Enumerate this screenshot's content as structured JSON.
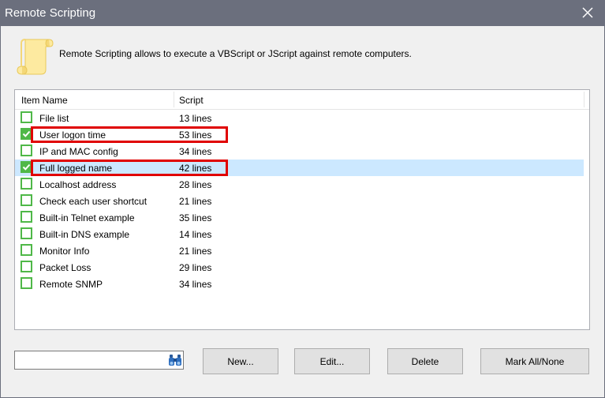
{
  "window": {
    "title": "Remote Scripting"
  },
  "description": "Remote Scripting allows to execute a VBScript or JScript against remote computers.",
  "list": {
    "columns": {
      "name": "Item Name",
      "script": "Script"
    },
    "rows": [
      {
        "name": "File list",
        "lines": "13 lines",
        "checked": false,
        "selected": false,
        "highlighted": false
      },
      {
        "name": "User logon time",
        "lines": "53 lines",
        "checked": true,
        "selected": false,
        "highlighted": true
      },
      {
        "name": "IP and MAC config",
        "lines": "34 lines",
        "checked": false,
        "selected": false,
        "highlighted": false
      },
      {
        "name": "Full logged name",
        "lines": "42 lines",
        "checked": true,
        "selected": true,
        "highlighted": true
      },
      {
        "name": "Localhost address",
        "lines": "28 lines",
        "checked": false,
        "selected": false,
        "highlighted": false
      },
      {
        "name": "Check each user shortcut",
        "lines": "21 lines",
        "checked": false,
        "selected": false,
        "highlighted": false
      },
      {
        "name": "Built-in Telnet example",
        "lines": "35 lines",
        "checked": false,
        "selected": false,
        "highlighted": false
      },
      {
        "name": "Built-in DNS example",
        "lines": "14 lines",
        "checked": false,
        "selected": false,
        "highlighted": false
      },
      {
        "name": "Monitor Info",
        "lines": "21 lines",
        "checked": false,
        "selected": false,
        "highlighted": false
      },
      {
        "name": "Packet Loss",
        "lines": "29 lines",
        "checked": false,
        "selected": false,
        "highlighted": false
      },
      {
        "name": "Remote SNMP",
        "lines": "34 lines",
        "checked": false,
        "selected": false,
        "highlighted": false
      }
    ]
  },
  "search": {
    "value": "",
    "icon": "binoculars-icon"
  },
  "buttons": {
    "new": "New...",
    "edit": "Edit...",
    "delete": "Delete",
    "mark_all": "Mark All/None"
  },
  "colors": {
    "titlebar": "#6b6f7d",
    "selection": "#cce8ff",
    "checkbox": "#4fb848",
    "highlight": "#e00000"
  }
}
